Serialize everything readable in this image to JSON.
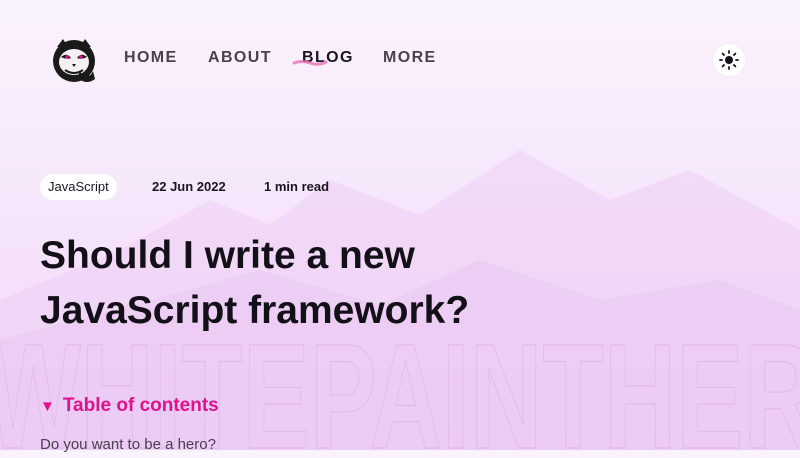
{
  "nav": {
    "items": [
      {
        "label": "HOME",
        "active": false
      },
      {
        "label": "ABOUT",
        "active": false
      },
      {
        "label": "BLOG",
        "active": true
      },
      {
        "label": "MORE",
        "active": false
      }
    ]
  },
  "icons": {
    "logo": "cat-face-logo-icon",
    "theme_toggle": "sun-icon",
    "toc_toggle": "triangle-down-icon"
  },
  "post": {
    "tag": "JavaScript",
    "date": "22 Jun 2022",
    "read_time": "1 min read",
    "title_line1": "Should I write a new",
    "title_line2": "JavaScript framework?"
  },
  "toc": {
    "label": "Table of contents",
    "items": [
      "Do you want to be a hero?"
    ]
  },
  "background": {
    "watermark": "WHITEPAINTHER"
  },
  "colors": {
    "accent": "#e0128d",
    "text": "#141018",
    "nav_text": "#4a4150",
    "bg_top": "#faf3fd",
    "bg_bottom": "#f1d5f8"
  }
}
